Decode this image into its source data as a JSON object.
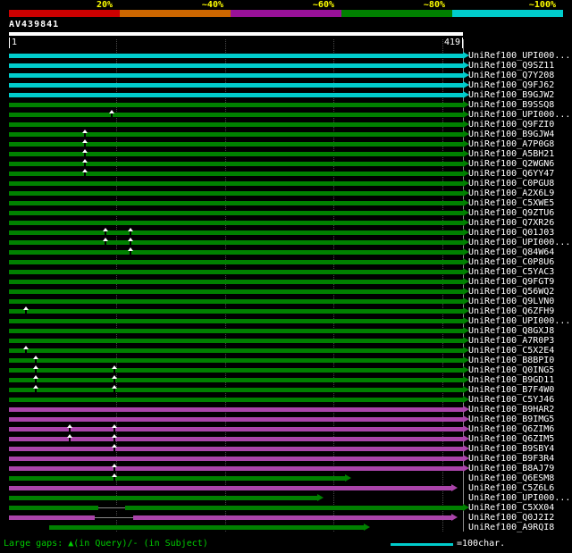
{
  "scale": {
    "labels": [
      "20%",
      "~40%",
      "~60%",
      "~80%",
      "~100%"
    ],
    "colors": [
      "#cc0000",
      "#cc6600",
      "#991199",
      "#008000",
      "#00cccc"
    ]
  },
  "query": {
    "name": "AV439841",
    "ruler_left": "1",
    "ruler_right": "419",
    "length": 419
  },
  "gridlines": [
    100,
    200,
    300,
    400
  ],
  "colors": {
    "cyan": "#00cccc",
    "green": "#008000",
    "magenta": "#aa44aa"
  },
  "rows": [
    {
      "label": "UniRef100_UPI000...",
      "color": "cyan",
      "start": 1,
      "end": 419
    },
    {
      "label": "UniRef100_Q9SZ11",
      "color": "cyan",
      "start": 1,
      "end": 419
    },
    {
      "label": "UniRef100_Q7Y208",
      "color": "cyan",
      "start": 1,
      "end": 419
    },
    {
      "label": "UniRef100_Q9FJ62",
      "color": "cyan",
      "start": 1,
      "end": 419
    },
    {
      "label": "UniRef100_B9GJW2",
      "color": "cyan",
      "start": 1,
      "end": 419
    },
    {
      "label": "UniRef100_B9SSQ8",
      "color": "green",
      "start": 1,
      "end": 419
    },
    {
      "label": "UniRef100_UPI000...",
      "color": "green",
      "start": 1,
      "end": 419,
      "gaps": [
        96
      ]
    },
    {
      "label": "UniRef100_Q9FZI0",
      "color": "green",
      "start": 1,
      "end": 419
    },
    {
      "label": "UniRef100_B9GJW4",
      "color": "green",
      "start": 1,
      "end": 419,
      "gaps": [
        71
      ]
    },
    {
      "label": "UniRef100_A7P0G8",
      "color": "green",
      "start": 1,
      "end": 419,
      "gaps": [
        71
      ]
    },
    {
      "label": "UniRef100_A5BH21",
      "color": "green",
      "start": 1,
      "end": 419,
      "gaps": [
        71
      ]
    },
    {
      "label": "UniRef100_Q2WGN6",
      "color": "green",
      "start": 1,
      "end": 419,
      "gaps": [
        71
      ]
    },
    {
      "label": "UniRef100_Q6YY47",
      "color": "green",
      "start": 1,
      "end": 419,
      "gaps": [
        71
      ]
    },
    {
      "label": "UniRef100_C0PGU8",
      "color": "green",
      "start": 1,
      "end": 419
    },
    {
      "label": "UniRef100_A2X6L9",
      "color": "green",
      "start": 1,
      "end": 419
    },
    {
      "label": "UniRef100_C5XWE5",
      "color": "green",
      "start": 1,
      "end": 419
    },
    {
      "label": "UniRef100_Q9ZTU6",
      "color": "green",
      "start": 1,
      "end": 419
    },
    {
      "label": "UniRef100_Q7XR26",
      "color": "green",
      "start": 1,
      "end": 419
    },
    {
      "label": "UniRef100_Q01J03",
      "color": "green",
      "start": 1,
      "end": 419,
      "gaps": [
        90,
        113
      ]
    },
    {
      "label": "UniRef100_UPI000...",
      "color": "green",
      "start": 1,
      "end": 419,
      "gaps": [
        90,
        113
      ]
    },
    {
      "label": "UniRef100_Q84W64",
      "color": "green",
      "start": 1,
      "end": 419,
      "gaps": [
        113
      ]
    },
    {
      "label": "UniRef100_C0P8U6",
      "color": "green",
      "start": 1,
      "end": 419
    },
    {
      "label": "UniRef100_C5YAC3",
      "color": "green",
      "start": 1,
      "end": 419
    },
    {
      "label": "UniRef100_Q9FGT9",
      "color": "green",
      "start": 1,
      "end": 419
    },
    {
      "label": "UniRef100_Q56WQ2",
      "color": "green",
      "start": 1,
      "end": 419
    },
    {
      "label": "UniRef100_Q9LVN0",
      "color": "green",
      "start": 1,
      "end": 419
    },
    {
      "label": "UniRef100_Q6ZFH9",
      "color": "green",
      "start": 1,
      "end": 419,
      "gaps": [
        17
      ]
    },
    {
      "label": "UniRef100_UPI000...",
      "color": "green",
      "start": 1,
      "end": 419
    },
    {
      "label": "UniRef100_Q8GXJ8",
      "color": "green",
      "start": 1,
      "end": 419
    },
    {
      "label": "UniRef100_A7R0P3",
      "color": "green",
      "start": 1,
      "end": 419
    },
    {
      "label": "UniRef100_C5X2E4",
      "color": "green",
      "start": 1,
      "end": 419,
      "gaps": [
        17
      ]
    },
    {
      "label": "UniRef100_B8BPI0",
      "color": "green",
      "start": 1,
      "end": 419,
      "gaps": [
        26
      ]
    },
    {
      "label": "UniRef100_Q0ING5",
      "color": "green",
      "start": 1,
      "end": 419,
      "gaps": [
        26,
        98
      ]
    },
    {
      "label": "UniRef100_B9GD11",
      "color": "green",
      "start": 1,
      "end": 419,
      "gaps": [
        26,
        98
      ]
    },
    {
      "label": "UniRef100_B7F4W0",
      "color": "green",
      "start": 1,
      "end": 419,
      "gaps": [
        26,
        98
      ]
    },
    {
      "label": "UniRef100_C5YJ46",
      "color": "green",
      "start": 1,
      "end": 419
    },
    {
      "label": "UniRef100_B9HAR2",
      "color": "magenta",
      "start": 1,
      "end": 419
    },
    {
      "label": "UniRef100_B9IMG5",
      "color": "magenta",
      "start": 1,
      "end": 419
    },
    {
      "label": "UniRef100_Q6ZIM6",
      "color": "magenta",
      "start": 1,
      "end": 419,
      "gaps": [
        57,
        98
      ]
    },
    {
      "label": "UniRef100_Q6ZIM5",
      "color": "magenta",
      "start": 1,
      "end": 419,
      "gaps": [
        57,
        98
      ]
    },
    {
      "label": "UniRef100_B9SBY4",
      "color": "magenta",
      "start": 1,
      "end": 419,
      "gaps": [
        98
      ]
    },
    {
      "label": "UniRef100_B9F3R4",
      "color": "magenta",
      "start": 1,
      "end": 419
    },
    {
      "label": "UniRef100_B8AJ79",
      "color": "magenta",
      "start": 1,
      "end": 419,
      "gaps": [
        98
      ]
    },
    {
      "label": "UniRef100_Q6ESM8",
      "color": "green",
      "start": 1,
      "end": 310,
      "gaps": [
        98
      ]
    },
    {
      "label": "UniRef100_C5Z6L6",
      "color": "magenta",
      "start": 1,
      "end": 408
    },
    {
      "label": "UniRef100_UPI000...",
      "color": "green",
      "start": 1,
      "end": 285
    },
    {
      "label": "UniRef100_C5XX04",
      "color": "green",
      "start": 1,
      "end": 419,
      "breaks": [
        [
          83,
          108
        ]
      ]
    },
    {
      "label": "UniRef100_Q0J2I2",
      "color": "magenta",
      "start": 1,
      "end": 408,
      "breaks": [
        [
          80,
          115
        ]
      ]
    },
    {
      "label": "UniRef100_A9RQI8",
      "color": "green",
      "start": 38,
      "end": 328
    }
  ],
  "footer": {
    "gaps_legend": "Large gaps: ▲(in Query)/- (in Subject)",
    "bar_legend": "=100char."
  }
}
